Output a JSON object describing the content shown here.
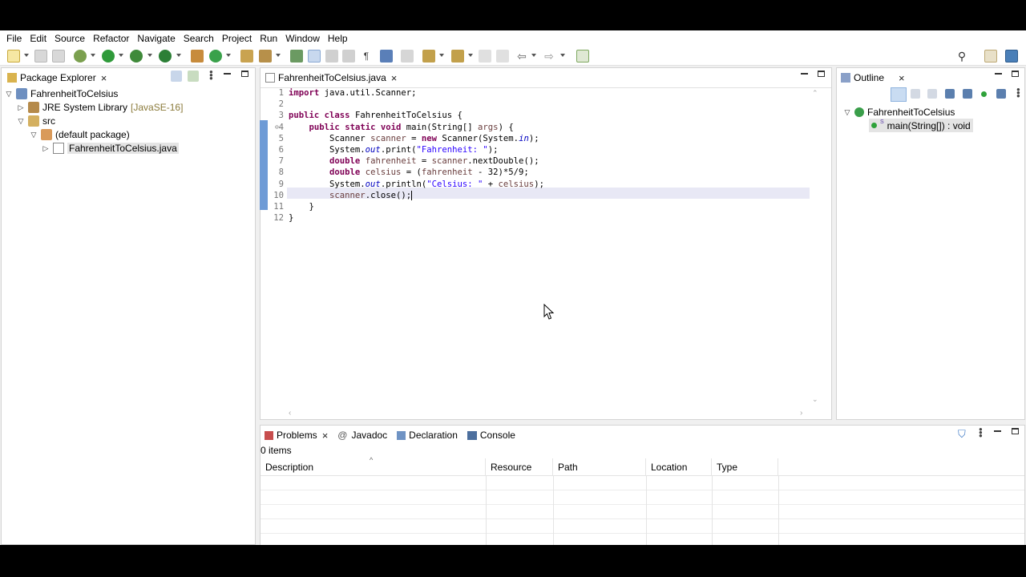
{
  "menu": [
    "File",
    "Edit",
    "Source",
    "Refactor",
    "Navigate",
    "Search",
    "Project",
    "Run",
    "Window",
    "Help"
  ],
  "package_explorer": {
    "title": "Package Explorer",
    "close": "×",
    "tree": [
      {
        "label": "FahrenheitToCelsius"
      },
      {
        "label": "JRE System Library",
        "suffix": "[JavaSE-16]"
      },
      {
        "label": "src"
      },
      {
        "label": "(default package)"
      },
      {
        "label": "FahrenheitToCelsius.java"
      }
    ]
  },
  "editor": {
    "tab": "FahrenheitToCelsius.java",
    "close": "×",
    "line_numbers": [
      "1",
      "2",
      "3",
      "4",
      "5",
      "6",
      "7",
      "8",
      "9",
      "10",
      "11",
      "12"
    ],
    "fold_marker": "⊖"
  },
  "outline": {
    "title": "Outline",
    "close": "×",
    "class_name": "FahrenheitToCelsius",
    "method": "main(String[]) : void",
    "static_marker": "S"
  },
  "bottom": {
    "tabs": [
      {
        "label": "Problems",
        "close": "×"
      },
      {
        "label": "Javadoc"
      },
      {
        "label": "Declaration"
      },
      {
        "label": "Console"
      }
    ],
    "count": "0 items",
    "columns": [
      "Description",
      "Resource",
      "Path",
      "Location",
      "Type"
    ],
    "sort_indicator": "^"
  },
  "colors": {
    "keyword": "#7f0055",
    "string": "#2a00ff",
    "variable": "#6a3e3e",
    "field": "#0000c0",
    "selection": "#e8e8f5",
    "change_bar": "#6e9bd6"
  }
}
